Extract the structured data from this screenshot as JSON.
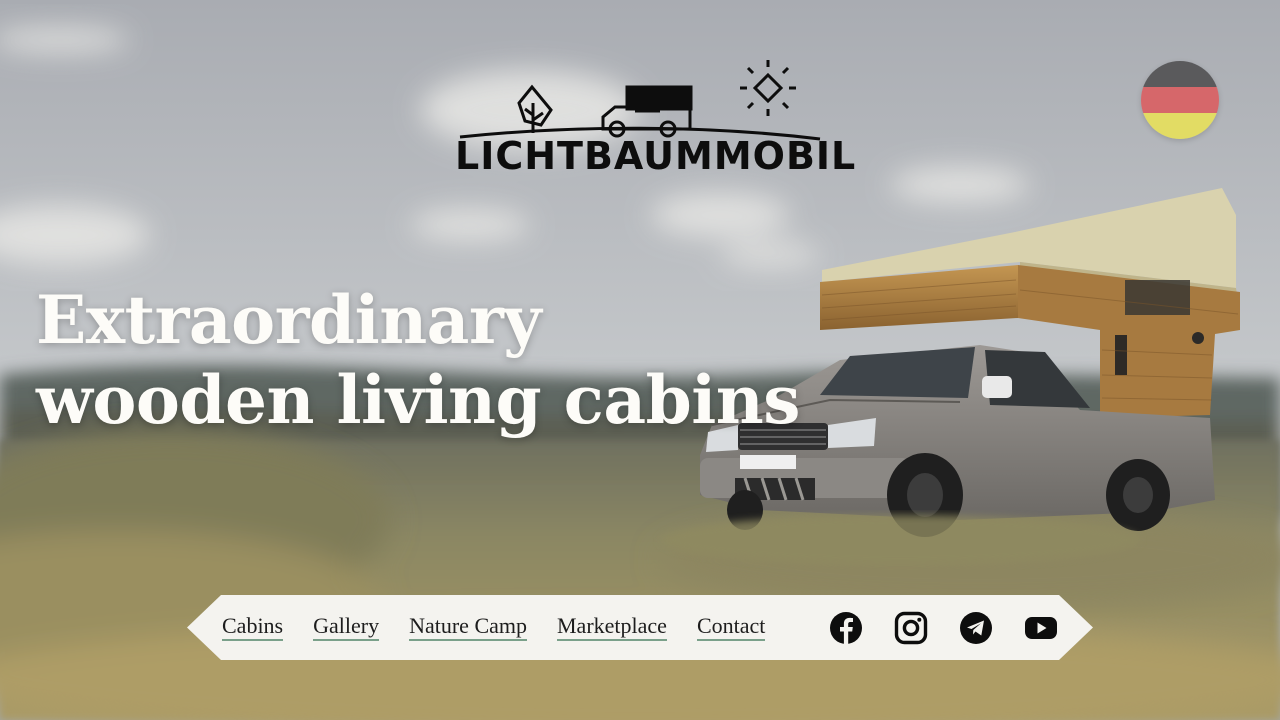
{
  "brand": {
    "name": "LICHTBAUMMOBIL"
  },
  "hero": {
    "headline_line1": "Extraordinary",
    "headline_line2": "wooden living cabins"
  },
  "language": {
    "flag": "germany-flag-icon",
    "colors": [
      "#5a5a5c",
      "#d6676a",
      "#e2dc64"
    ]
  },
  "nav": {
    "items": [
      {
        "label": "Cabins"
      },
      {
        "label": "Gallery"
      },
      {
        "label": "Nature Camp"
      },
      {
        "label": "Marketplace"
      },
      {
        "label": "Contact"
      }
    ],
    "social": [
      {
        "icon": "facebook-icon"
      },
      {
        "icon": "instagram-icon"
      },
      {
        "icon": "telegram-icon"
      },
      {
        "icon": "youtube-icon"
      }
    ]
  },
  "colors": {
    "headline": "#fdfcf8",
    "nav_background": "#f4f3ef",
    "nav_underline": "#7aa08a",
    "icon": "#0d0d0d"
  }
}
